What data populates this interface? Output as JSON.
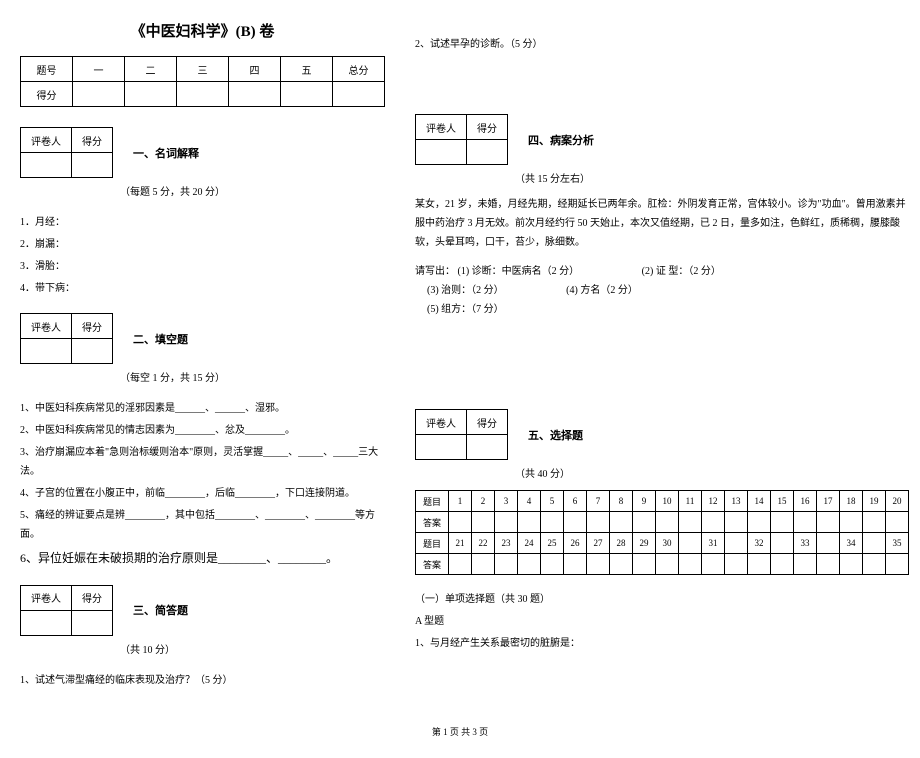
{
  "title": "《中医妇科学》(B)  卷",
  "score_table": {
    "row1": [
      "题号",
      "一",
      "二",
      "三",
      "四",
      "五",
      "总分"
    ],
    "row2_label": "得分"
  },
  "grader": {
    "col1": "评卷人",
    "col2": "得分"
  },
  "sections": {
    "s1": {
      "title": "一、名词解释",
      "subtitle": "（每题 5 分，共 20 分）",
      "items": [
        "1．月经：",
        "2．崩漏：",
        "3．滑胎：",
        "4．带下病："
      ]
    },
    "s2": {
      "title": "二、填空题",
      "subtitle": "（每空 1 分，共 15 分）",
      "items": [
        "1、中医妇科疾病常见的淫邪因素是______、______、湿邪。",
        "2、中医妇科疾病常见的情志因素为________、忿及________。",
        "3、治疗崩漏应本着\"急则治标缓则治本\"原则，灵活掌握_____、_____、_____三大法。",
        "4、子宫的位置在小腹正中，前临________，后临________，下口连接阴道。",
        "5、痛经的辨证要点是辨________，其中包括________、________、________等方面。"
      ],
      "q6": "6、异位妊娠在未破损期的治疗原则是________、________。"
    },
    "s3": {
      "title": "三、简答题",
      "subtitle": "（共 10 分）",
      "q1": "1、试述气滞型痛经的临床表现及治疗？（5 分）",
      "q2": "2、试述早孕的诊断。（5 分）"
    },
    "s4": {
      "title": "四、病案分析",
      "subtitle": "（共 15 分左右）",
      "case": "某女，21 岁，未婚，月经先期，经期延长已两年余。肛检：外阴发育正常，宫体较小。诊为\"功血\"。曾用激素并服中药治疗 3 月无效。前次月经约行 50 天始止，本次又值经期，已 2 日，量多如注，色鲜红，质稀稠，腰膝酸软，头晕耳鸣，口干，苔少，脉细数。",
      "parts": {
        "intro": "请写出：",
        "p1": "(1) 诊断：中医病名（2 分）",
        "p2": "(2) 证  型：（2 分）",
        "p3": "(3) 治则：（2 分）",
        "p4": "(4)  方名（2 分）",
        "p5": "(5) 组方：（7 分）"
      }
    },
    "s5": {
      "title": "五、选择题",
      "subtitle": "（共 40 分）",
      "row_labels": {
        "num": "题目",
        "ans": "答案"
      },
      "nums1": [
        "1",
        "2",
        "3",
        "4",
        "5",
        "6",
        "7",
        "8",
        "9",
        "10",
        "11",
        "12",
        "13",
        "14",
        "15",
        "16",
        "17",
        "18",
        "19",
        "20"
      ],
      "nums2": [
        "21",
        "22",
        "23",
        "24",
        "25",
        "26",
        "27",
        "28",
        "29",
        "30",
        "",
        "31",
        "",
        "32",
        "",
        "33",
        "",
        "34",
        "",
        "35"
      ],
      "sub1": "（一）单项选择题（共 30 题）",
      "sub2": "A 型题",
      "q1": "1、与月经产生关系最密切的脏腑是："
    }
  },
  "footer": "第 1 页 共 3 页"
}
